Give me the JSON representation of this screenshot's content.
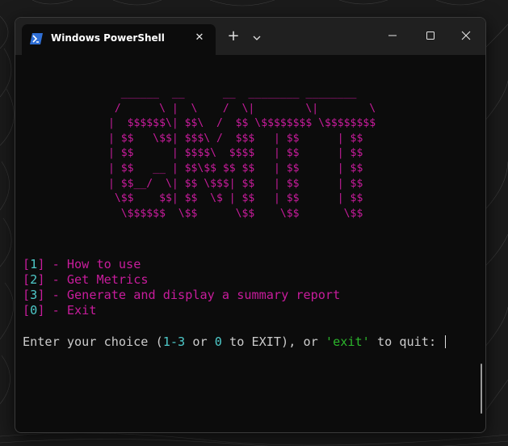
{
  "window": {
    "tab_title": "Windows PowerShell",
    "tab_icon": "powershell-icon",
    "accent": "#2f6fd6"
  },
  "terminal": {
    "banner": [
      "  ______  __      __  ________ ________",
      " /      \\ |  \\    /  \\|        \\|        \\",
      "|  $$$$$$\\| $$\\  /  $$ \\$$$$$$$$ \\$$$$$$$$",
      "| $$   \\$$| $$$\\ /  $$$   | $$      | $$",
      "| $$      | $$$$\\  $$$$   | $$      | $$",
      "| $$   __ | $$\\$$ $$ $$   | $$      | $$",
      "| $$__/  \\| $$ \\$$$| $$   | $$      | $$",
      " \\$$    $$| $$  \\$ | $$   | $$      | $$",
      "  \\$$$$$$  \\$$      \\$$    \\$$       \\$$"
    ],
    "menu": [
      {
        "key": "1",
        "label": " - How to use"
      },
      {
        "key": "2",
        "label": " - Get Metrics"
      },
      {
        "key": "3",
        "label": " - Generate and display a summary report"
      },
      {
        "key": "0",
        "label": " - Exit"
      }
    ],
    "prompt": {
      "part1": "Enter your choice (",
      "range": "1-3",
      "part2": " or ",
      "zero": "0",
      "part3": " to EXIT), or ",
      "exit_word": "'exit'",
      "part4": " to quit: "
    },
    "colors": {
      "magenta": "#c81c9c",
      "cyan": "#4ec9c9",
      "green": "#2bb52b",
      "text": "#cccccc",
      "background": "#0c0c0c"
    }
  }
}
